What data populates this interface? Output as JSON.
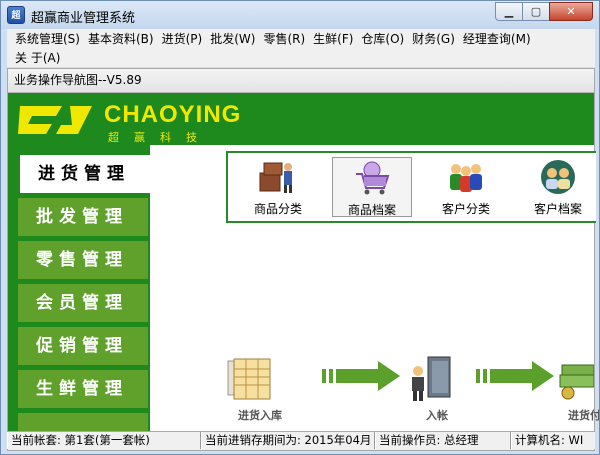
{
  "window": {
    "title": "超赢商业管理系统",
    "icon_text": "超"
  },
  "menu": {
    "row1": [
      "系统管理(S)",
      "基本资料(B)",
      "进货(P)",
      "批发(W)",
      "零售(R)",
      "生鲜(F)",
      "仓库(O)",
      "财务(G)",
      "经理查询(M)"
    ],
    "row2": [
      "关 于(A)"
    ]
  },
  "panel": {
    "title": "业务操作导航图--V5.89"
  },
  "logo": {
    "main": "CHAOYING",
    "sub": "超赢科技"
  },
  "nav": {
    "items": [
      "进货管理",
      "批发管理",
      "零售管理",
      "会员管理",
      "促销管理",
      "生鲜管理"
    ],
    "active_index": 0
  },
  "toolbar": {
    "buttons": [
      {
        "label": "商品分类",
        "icon": "boxes-icon"
      },
      {
        "label": "商品档案",
        "icon": "shopping-cart-icon"
      },
      {
        "label": "客户分类",
        "icon": "people-group-icon"
      },
      {
        "label": "客户档案",
        "icon": "customer-profile-icon"
      }
    ]
  },
  "flow": {
    "steps": [
      {
        "label": "进货入库",
        "icon": "receipt-stock-icon"
      },
      {
        "label": "入帐",
        "icon": "person-door-icon"
      },
      {
        "label": "进货付",
        "icon": "money-icon"
      }
    ]
  },
  "status": {
    "account": "当前帐套: 第1套(第一套帐)",
    "period": "当前进销存期间为: 2015年04月",
    "operator": "当前操作员: 总经理",
    "computer": "计算机名: WI"
  },
  "colors": {
    "green_dark": "#1e8a1e",
    "green_nav": "#5fa12b",
    "logo_yellow": "#f0e800",
    "arrow_green": "#5aa02a"
  }
}
